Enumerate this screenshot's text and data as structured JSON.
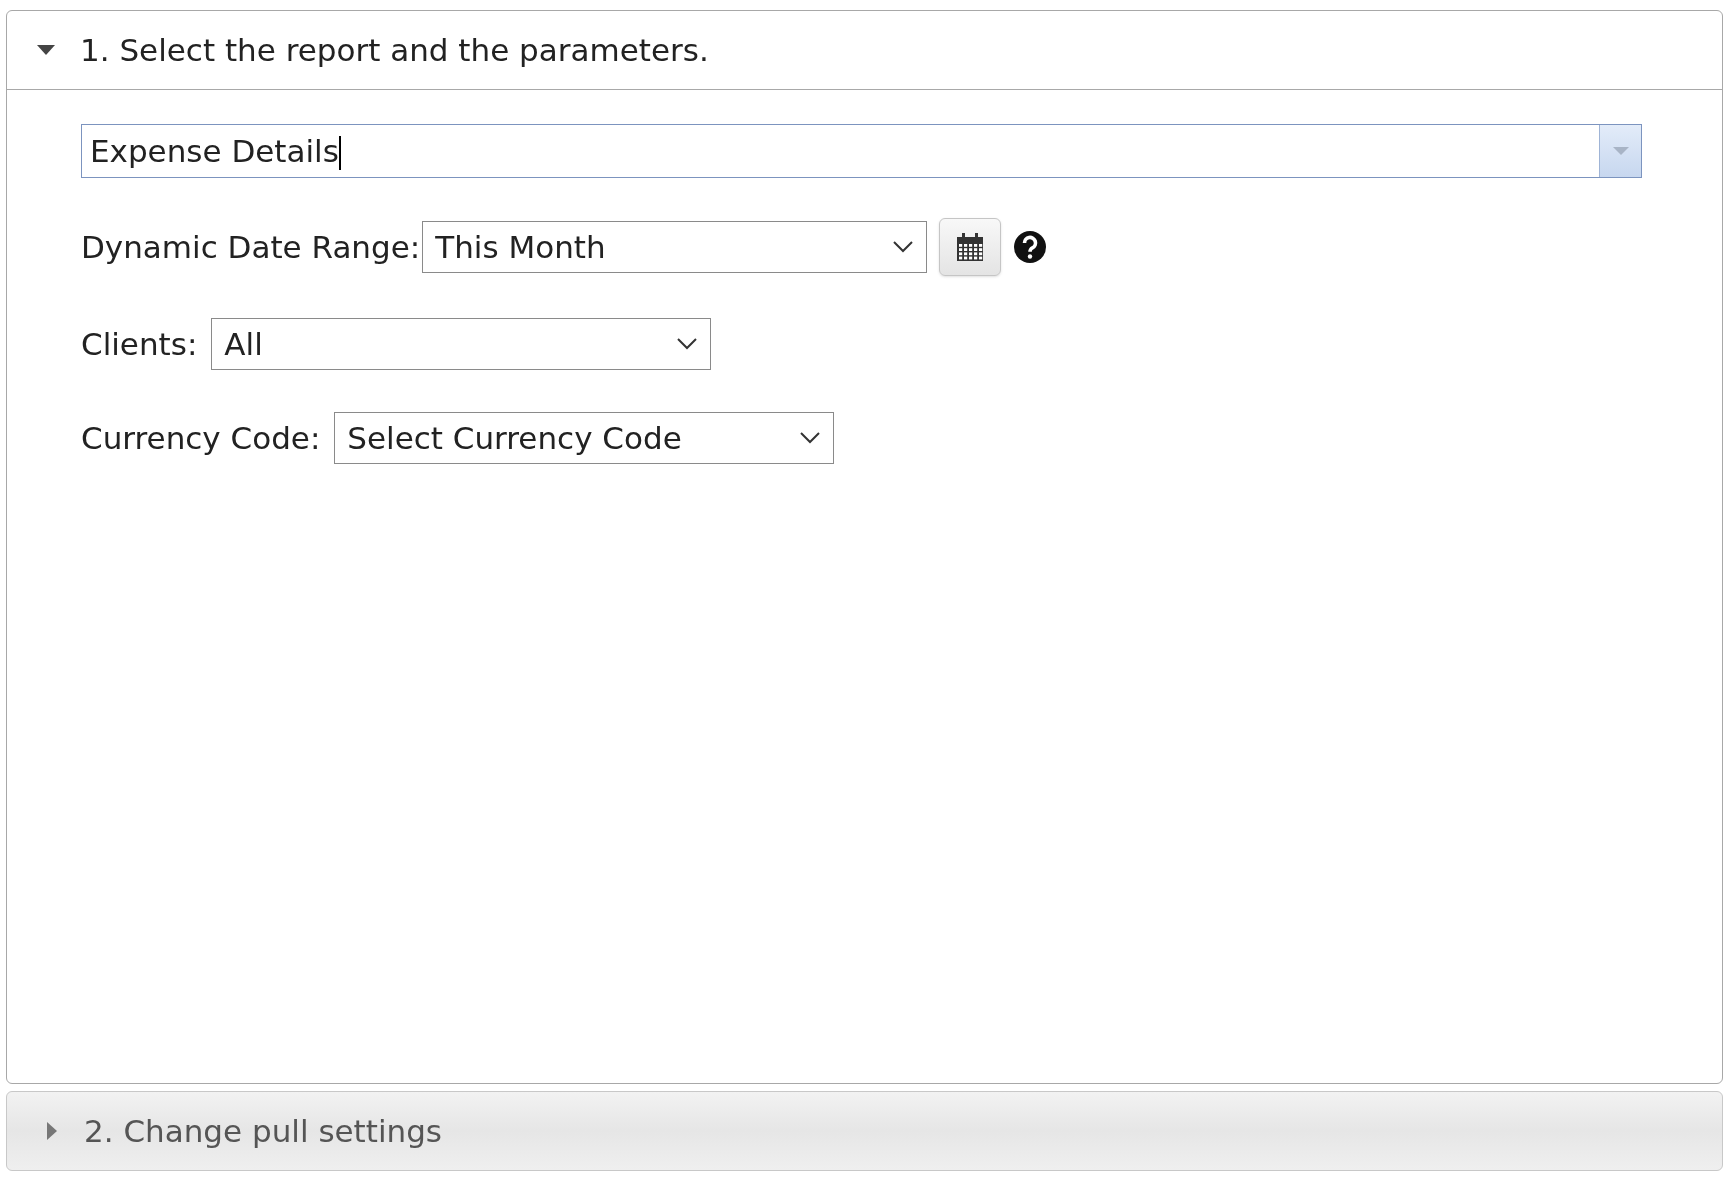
{
  "sections": [
    {
      "title": "1. Select the report and the parameters.",
      "expanded": true,
      "report": {
        "value": "Expense Details"
      },
      "parameters": [
        {
          "kind": "date",
          "label": "Dynamic Date Range:",
          "value": "This Month"
        },
        {
          "kind": "select",
          "label": "Clients:",
          "value": "All"
        },
        {
          "kind": "select",
          "label": "Currency Code:",
          "value": "Select Currency Code"
        }
      ]
    },
    {
      "title": "2. Change pull settings",
      "expanded": false
    }
  ]
}
